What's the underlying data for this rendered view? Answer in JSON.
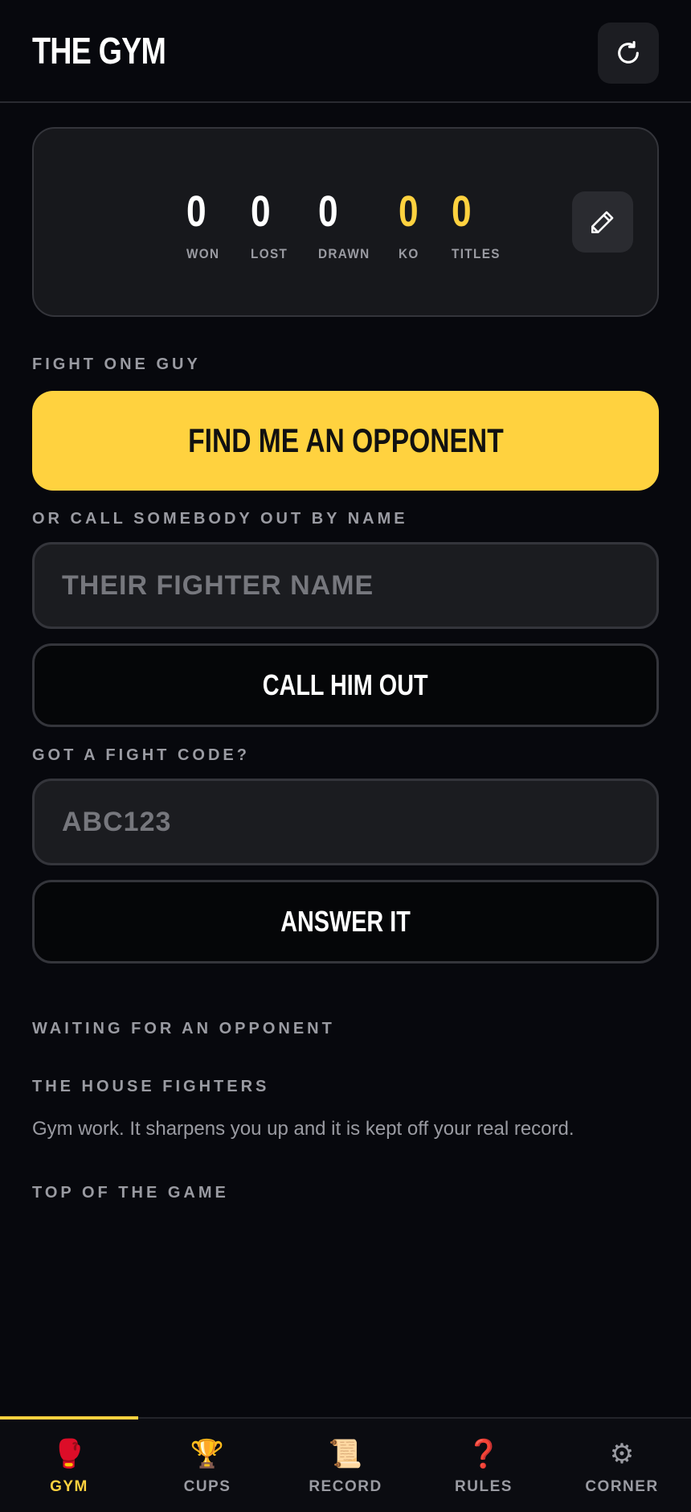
{
  "header": {
    "title": "THE GYM",
    "refresh_icon": "refresh-icon"
  },
  "stats": {
    "won": {
      "value": "0",
      "label": "WON"
    },
    "lost": {
      "value": "0",
      "label": "LOST"
    },
    "drawn": {
      "value": "0",
      "label": "DRAWN"
    },
    "ko": {
      "value": "0",
      "label": "KO"
    },
    "titles": {
      "value": "0",
      "label": "TITLES"
    },
    "edit_icon": "pencil-icon",
    "accent_color": "#ffd23f"
  },
  "fight_one": {
    "label": "FIGHT ONE GUY",
    "button_label": "FIND ME AN OPPONENT"
  },
  "call_out": {
    "label": "OR CALL SOMEBODY OUT BY NAME",
    "input_value": "",
    "input_placeholder": "THEIR FIGHTER NAME",
    "button_label": "CALL HIM OUT"
  },
  "fight_code": {
    "label": "GOT A FIGHT CODE?",
    "input_value": "",
    "input_placeholder": "ABC123",
    "button_label": "ANSWER IT"
  },
  "waiting": {
    "label": "WAITING FOR AN OPPONENT"
  },
  "house_fighters": {
    "label": "THE HOUSE FIGHTERS",
    "description": "Gym work. It sharpens you up and it is kept off your real record."
  },
  "top_of_game": {
    "label": "TOP OF THE GAME"
  },
  "nav": {
    "items": [
      {
        "icon": "🥊",
        "label": "GYM",
        "active": true
      },
      {
        "icon": "🏆",
        "label": "CUPS",
        "active": false
      },
      {
        "icon": "📜",
        "label": "RECORD",
        "active": false
      },
      {
        "icon": "❓",
        "label": "RULES",
        "active": false
      },
      {
        "icon": "⚙",
        "label": "CORNER",
        "active": false
      }
    ]
  }
}
